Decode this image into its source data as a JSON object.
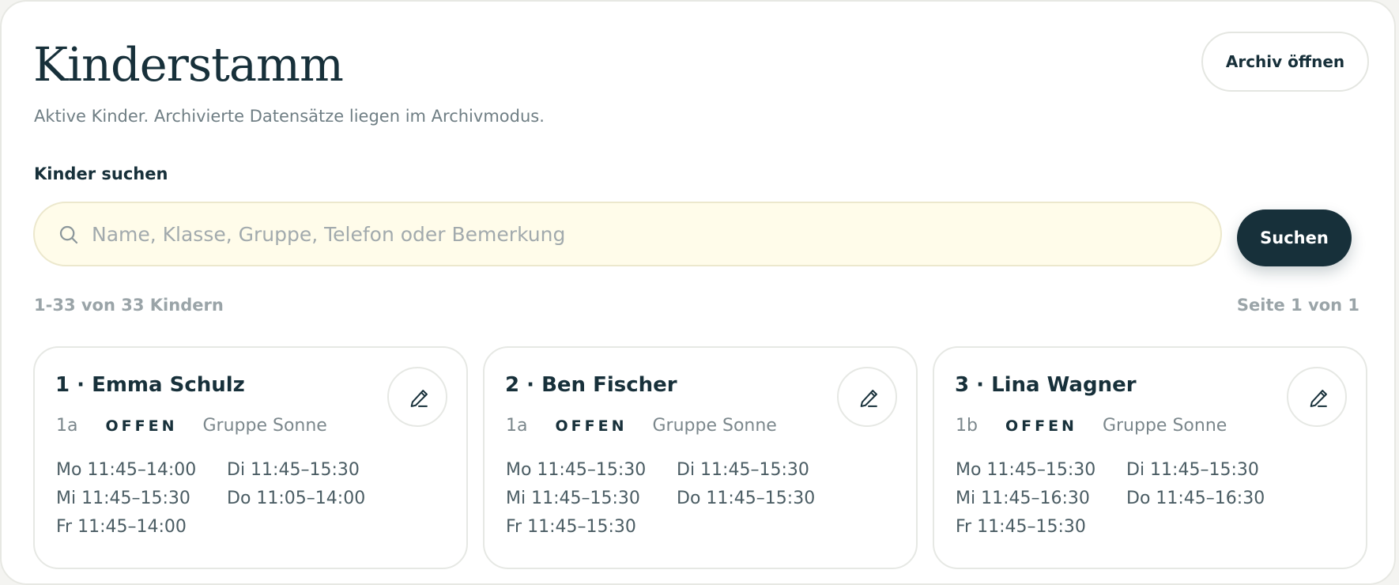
{
  "header": {
    "title": "Kinderstamm",
    "subtitle": "Aktive Kinder. Archivierte Datensätze liegen im Archivmodus.",
    "archive_button": "Archiv öffnen"
  },
  "search": {
    "label": "Kinder suchen",
    "value": "",
    "placeholder": "Name, Klasse, Gruppe, Telefon oder Bemerkung",
    "button": "Suchen"
  },
  "results": {
    "count": "1-33 von 33 Kindern",
    "page": "Seite 1 von 1"
  },
  "icons": {
    "search": "search-icon",
    "edit": "pencil-icon"
  },
  "colors": {
    "primary": "#17303a",
    "search_background": "#fffcea",
    "muted_text": "#9aa4a8"
  },
  "cards": [
    {
      "title": "1 · Emma Schulz",
      "class": "1a",
      "status": "OFFEN",
      "group": "Gruppe Sonne",
      "times": [
        "Mo 11:45–14:00",
        "Di 11:45–15:30",
        "Mi 11:45–15:30",
        "Do 11:05–14:00",
        "Fr 11:45–14:00"
      ]
    },
    {
      "title": "2 · Ben Fischer",
      "class": "1a",
      "status": "OFFEN",
      "group": "Gruppe Sonne",
      "times": [
        "Mo 11:45–15:30",
        "Di 11:45–15:30",
        "Mi 11:45–15:30",
        "Do 11:45–15:30",
        "Fr 11:45–15:30"
      ]
    },
    {
      "title": "3 · Lina Wagner",
      "class": "1b",
      "status": "OFFEN",
      "group": "Gruppe Sonne",
      "times": [
        "Mo 11:45–15:30",
        "Di 11:45–15:30",
        "Mi 11:45–16:30",
        "Do 11:45–16:30",
        "Fr 11:45–15:30"
      ]
    }
  ]
}
